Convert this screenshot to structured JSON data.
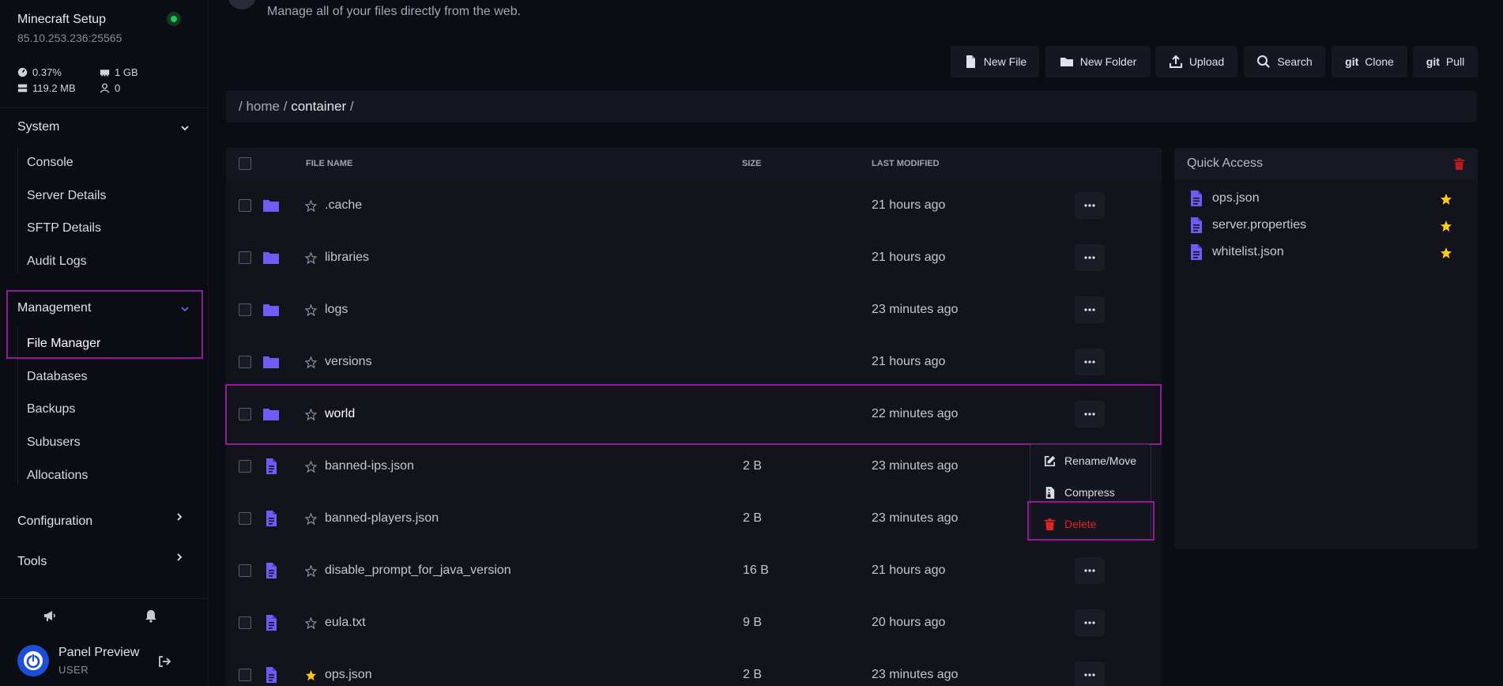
{
  "server": {
    "name": "Minecraft Setup",
    "address": "85.10.253.236:25565",
    "status_color": "#22c55e",
    "stats": {
      "cpu": "0.37%",
      "memory": "1 GB",
      "disk": "119.2 MB",
      "players": "0"
    }
  },
  "sidebar": {
    "sections": [
      {
        "title": "System",
        "expanded": true,
        "items": [
          "Console",
          "Server Details",
          "SFTP Details",
          "Audit Logs"
        ]
      },
      {
        "title": "Management",
        "expanded": true,
        "items": [
          "File Manager",
          "Databases",
          "Backups",
          "Subusers",
          "Allocations"
        ],
        "active_item": "File Manager"
      },
      {
        "title": "Configuration",
        "expanded": false,
        "items": []
      },
      {
        "title": "Tools",
        "expanded": false,
        "items": []
      }
    ],
    "bottom_icons": [
      "megaphone-icon",
      "bell-icon"
    ],
    "user": {
      "name": "Panel Preview",
      "role": "USER"
    }
  },
  "header": {
    "subtitle": "Manage all of your files directly from the web."
  },
  "toolbar": {
    "new_file": "New File",
    "new_folder": "New Folder",
    "upload": "Upload",
    "search": "Search",
    "git_word": "git",
    "clone": "Clone",
    "pull": "Pull"
  },
  "breadcrumb": {
    "sep": "/",
    "home": "home",
    "container": "container"
  },
  "table": {
    "headers": {
      "name": "FILE NAME",
      "size": "SIZE",
      "modified": "LAST MODIFIED"
    },
    "rows": [
      {
        "type": "folder",
        "name": ".cache",
        "size": "",
        "modified": "21 hours ago",
        "starred": false
      },
      {
        "type": "folder",
        "name": "libraries",
        "size": "",
        "modified": "21 hours ago",
        "starred": false
      },
      {
        "type": "folder",
        "name": "logs",
        "size": "",
        "modified": "23 minutes ago",
        "starred": false
      },
      {
        "type": "folder",
        "name": "versions",
        "size": "",
        "modified": "21 hours ago",
        "starred": false
      },
      {
        "type": "folder",
        "name": "world",
        "size": "",
        "modified": "22 minutes ago",
        "starred": false
      },
      {
        "type": "file",
        "name": "banned-ips.json",
        "size": "2 B",
        "modified": "23 minutes ago",
        "starred": false
      },
      {
        "type": "file",
        "name": "banned-players.json",
        "size": "2 B",
        "modified": "23 minutes ago",
        "starred": false
      },
      {
        "type": "file",
        "name": "disable_prompt_for_java_version",
        "size": "16 B",
        "modified": "21 hours ago",
        "starred": false
      },
      {
        "type": "file",
        "name": "eula.txt",
        "size": "9 B",
        "modified": "20 hours ago",
        "starred": false
      },
      {
        "type": "file",
        "name": "ops.json",
        "size": "2 B",
        "modified": "23 minutes ago",
        "starred": true
      }
    ]
  },
  "context_menu": {
    "rename": "Rename/Move",
    "compress": "Compress",
    "delete": "Delete"
  },
  "quick_access": {
    "title": "Quick Access",
    "items": [
      "ops.json",
      "server.properties",
      "whitelist.json"
    ]
  },
  "colors": {
    "accent": "#6f5cf6",
    "danger": "#dc2626",
    "star": "#facc15",
    "highlight": "#8d1f96"
  }
}
